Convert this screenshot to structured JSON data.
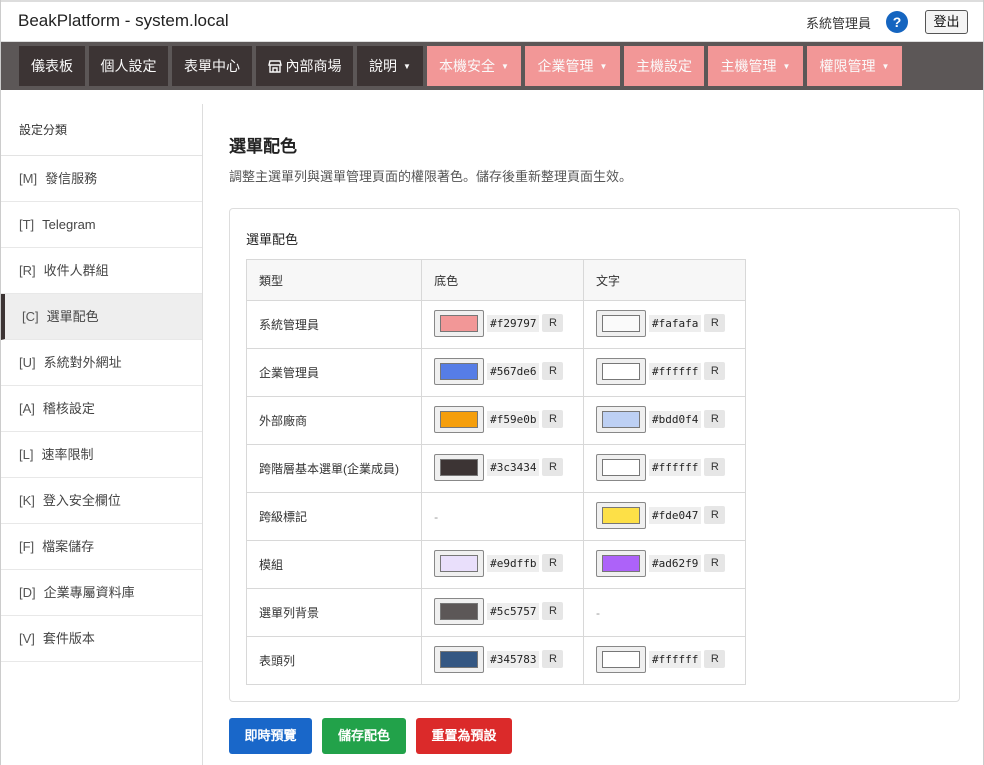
{
  "app": {
    "title": "BeakPlatform - system.local",
    "user": "系統管理員",
    "help": "?",
    "logout": "登出"
  },
  "nav": {
    "items": [
      {
        "label": "儀表板"
      },
      {
        "label": "個人設定"
      },
      {
        "label": "表單中心"
      },
      {
        "label": "內部商場"
      },
      {
        "label": "說明",
        "caret": "▼"
      },
      {
        "label": "本機安全",
        "caret": "▼"
      },
      {
        "label": "企業管理",
        "caret": "▼"
      },
      {
        "label": "主機設定"
      },
      {
        "label": "主機管理",
        "caret": "▼"
      },
      {
        "label": "權限管理",
        "caret": "▼"
      }
    ],
    "colors": {
      "dark": "#3c3434",
      "pink": "#f29797",
      "bar": "#5c5757"
    }
  },
  "sidebar": {
    "heading": "設定分類",
    "items": [
      {
        "key": "[M]",
        "label": "發信服務"
      },
      {
        "key": "[T]",
        "label": "Telegram"
      },
      {
        "key": "[R]",
        "label": "收件人群組"
      },
      {
        "key": "[C]",
        "label": "選單配色"
      },
      {
        "key": "[U]",
        "label": "系統對外網址"
      },
      {
        "key": "[A]",
        "label": "稽核設定"
      },
      {
        "key": "[L]",
        "label": "速率限制"
      },
      {
        "key": "[K]",
        "label": "登入安全欄位"
      },
      {
        "key": "[F]",
        "label": "檔案儲存"
      },
      {
        "key": "[D]",
        "label": "企業專屬資料庫"
      },
      {
        "key": "[V]",
        "label": "套件版本"
      }
    ]
  },
  "main": {
    "title": "選單配色",
    "description": "調整主選單列與選單管理頁面的權限著色。儲存後重新整理頁面生效。",
    "card_title": "選單配色",
    "headers": [
      "類型",
      "底色",
      "文字"
    ],
    "reset_label": "R",
    "empty": "-",
    "rows": [
      {
        "type": "系統管理員",
        "bg": "#f29797",
        "fg": "#fafafa"
      },
      {
        "type": "企業管理員",
        "bg": "#567de6",
        "fg": "#ffffff"
      },
      {
        "type": "外部廠商",
        "bg": "#f59e0b",
        "fg": "#bdd0f4"
      },
      {
        "type": "跨階層基本選單(企業成員)",
        "bg": "#3c3434",
        "fg": "#ffffff"
      },
      {
        "type": "跨級標記",
        "bg": null,
        "fg": "#fde047"
      },
      {
        "type": "模組",
        "bg": "#e9dffb",
        "fg": "#ad62f9"
      },
      {
        "type": "選單列背景",
        "bg": "#5c5757",
        "fg": null
      },
      {
        "type": "表頭列",
        "bg": "#345783",
        "fg": "#ffffff"
      }
    ],
    "buttons": {
      "preview": "即時預覽",
      "save": "儲存配色",
      "reset": "重置為預設"
    }
  }
}
